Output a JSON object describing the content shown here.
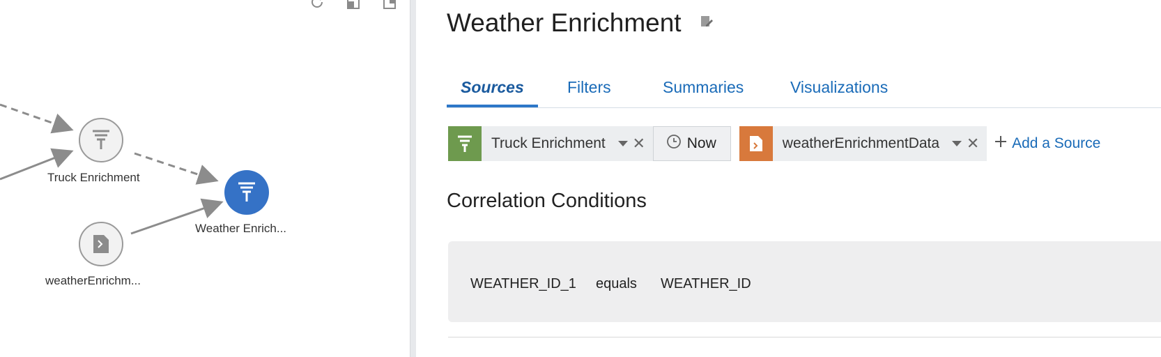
{
  "canvas": {
    "tools": [
      "refresh-icon",
      "layout-icon",
      "export-icon"
    ],
    "nodes": [
      {
        "name": "truck-enrichment-node",
        "label": "Truck Enrichment",
        "icon": "filter-icon",
        "state": "default"
      },
      {
        "name": "weather-enrichment-node",
        "label": "Weather Enrich...",
        "icon": "filter-icon",
        "state": "selected"
      },
      {
        "name": "weather-source-node",
        "label": "weatherEnrichm...",
        "icon": "file-icon",
        "state": "default"
      }
    ]
  },
  "panel": {
    "title": "Weather Enrichment",
    "tabs": [
      {
        "label": "Sources",
        "active": true
      },
      {
        "label": "Filters"
      },
      {
        "label": "Summaries"
      },
      {
        "label": "Visualizations"
      }
    ],
    "sources": [
      {
        "label": "Truck Enrichment",
        "icon": "filter-icon",
        "color": "#6e9a4e"
      },
      {
        "label": "Now",
        "icon": "clock-icon"
      },
      {
        "label": "weatherEnrichmentData",
        "icon": "file-icon",
        "color": "#d8793c"
      }
    ],
    "add_source": "Add a Source",
    "section_title": "Correlation Conditions",
    "condition": {
      "left": "WEATHER_ID_1",
      "op": "equals",
      "right": "WEATHER_ID"
    }
  },
  "colors": {
    "accent": "#2d77c8",
    "link": "#1a6bb8",
    "node_selected": "#3572c6"
  }
}
